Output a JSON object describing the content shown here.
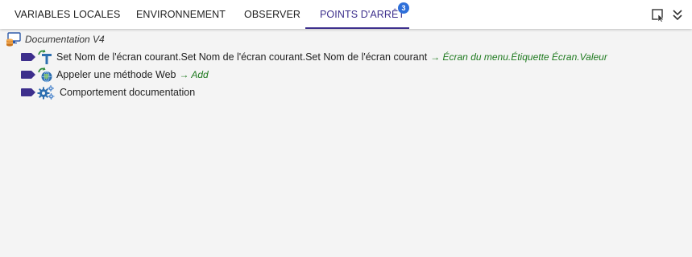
{
  "tabs": [
    {
      "label": "VARIABLES LOCALES"
    },
    {
      "label": "ENVIRONNEMENT"
    },
    {
      "label": "OBSERVER"
    },
    {
      "label": "POINTS D'ARRÊT",
      "badge": "3",
      "active": true
    }
  ],
  "toolbar": {
    "icons": [
      "select-window-icon",
      "collapse-chevrons-icon"
    ]
  },
  "tree": {
    "root": {
      "label": "Documentation V4",
      "icon": "database-monitor-icon"
    },
    "items": [
      {
        "label": "Set Nom de l'écran courant.Set Nom de l'écran courant.Set Nom de l'écran courant",
        "target": "→ Écran du menu.Étiquette Écran.Valeur",
        "icon": "set-text-icon"
      },
      {
        "label": "Appeler une méthode Web",
        "target": "→ Add",
        "icon": "web-method-icon"
      },
      {
        "label": "Comportement documentation",
        "target": "",
        "icon": "gears-icon"
      }
    ]
  },
  "colors": {
    "accent": "#3d2f8c",
    "badge": "#2e6fd9",
    "target_text": "#1f7a1f",
    "background": "#f4f4f4"
  }
}
